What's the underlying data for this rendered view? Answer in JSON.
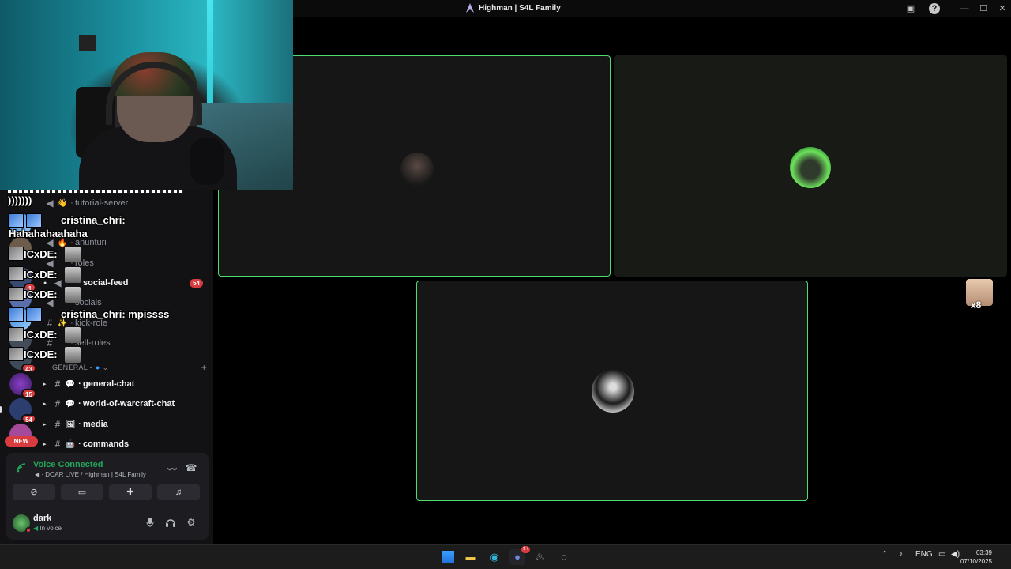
{
  "window": {
    "title": "Highman | S4L Family",
    "controls": [
      "minimize",
      "maximize",
      "close"
    ]
  },
  "channels": [
    {
      "name": "tutorial-server",
      "icon": "speaker-icon",
      "emoji": "👋",
      "unread": false
    },
    {
      "name": "anunturi",
      "icon": "speaker-icon",
      "emoji": "🔥",
      "unread": false
    },
    {
      "name": "roles",
      "icon": "speaker-icon",
      "emoji": "",
      "unread": false
    },
    {
      "name": "social-feed",
      "icon": "speaker-icon",
      "emoji": "",
      "unread": true,
      "mention": "54"
    },
    {
      "name": "socials",
      "icon": "speaker-icon",
      "emoji": "",
      "unread": false
    },
    {
      "name": "kick-role",
      "icon": "hash-icon",
      "emoji": "✨",
      "unread": false
    },
    {
      "name": "self-roles",
      "icon": "hash-icon",
      "emoji": "",
      "unread": false
    }
  ],
  "category": {
    "label": "GENERAL -",
    "add": "+"
  },
  "text_channels": [
    {
      "name": "general-chat",
      "emoji": "💬"
    },
    {
      "name": "world-of-warcraft-chat",
      "emoji": "💬"
    },
    {
      "name": "media",
      "emoji": "🖼"
    },
    {
      "name": "commands",
      "emoji": "🤖"
    }
  ],
  "servers": [
    {
      "badge": ""
    },
    {
      "badge": ""
    },
    {
      "badge": "1"
    },
    {
      "badge": ""
    },
    {
      "badge": ""
    },
    {
      "badge": ""
    },
    {
      "badge": "43"
    },
    {
      "badge": "15"
    },
    {
      "badge": "54"
    },
    {
      "badge": ""
    }
  ],
  "server_new_label": "NEW",
  "chat_overlay": {
    "header": ")))))))",
    "messages": [
      {
        "user": "cristina_chri:",
        "text": ""
      },
      {
        "user": "",
        "text": "Hahahahaahaha"
      },
      {
        "user": "ICxDE:",
        "text": ""
      },
      {
        "user": "ICxDE:",
        "text": ""
      },
      {
        "user": "ICxDE:",
        "text": ""
      },
      {
        "user": "cristina_chri:",
        "text": "mpissss"
      },
      {
        "user": "ICxDE:",
        "text": ""
      },
      {
        "user": "ICxDE:",
        "text": ""
      }
    ]
  },
  "voice": {
    "status": "Voice Connected",
    "location": "DOAR LIVE / Highman | S4L Family"
  },
  "user": {
    "name": "dark",
    "status": "In voice"
  },
  "overflow_participants": "x8",
  "taskbar": {
    "tray_lang": "ENG",
    "time": "03:39",
    "date": "07/10/2025",
    "discord_badge": "9+"
  },
  "colors": {
    "speaking_border": "#4fdc6f",
    "voice_green": "#23a55a",
    "mention_red": "#d83c3e"
  }
}
